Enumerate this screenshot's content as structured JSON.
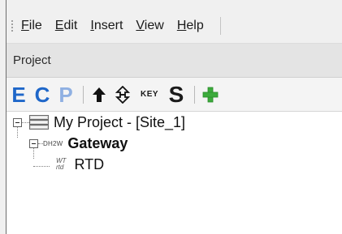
{
  "menubar": {
    "items": [
      {
        "accel": "F",
        "rest": "ile"
      },
      {
        "accel": "E",
        "rest": "dit"
      },
      {
        "accel": "I",
        "rest": "nsert"
      },
      {
        "accel": "V",
        "rest": "iew"
      },
      {
        "accel": "H",
        "rest": "elp"
      }
    ]
  },
  "panel": {
    "title": "Project"
  },
  "toolbar": {
    "e_label": "E",
    "c_label": "C",
    "p_label": "P",
    "key_label": "KEY",
    "s_label": "S",
    "icons": [
      "arrow-up-icon",
      "double-arrow-icon",
      "add-icon"
    ],
    "colors": {
      "blue": "#1f67c9",
      "disabled_blue": "#8fb0e2",
      "green": "#3cab3c"
    }
  },
  "tree": {
    "root": {
      "label": "My Project - [Site_1]",
      "icon": "server-icon"
    },
    "gateway": {
      "tag": "DH2W",
      "label": "Gateway"
    },
    "rtd": {
      "tag_top": "WT",
      "tag_bottom": "rtd",
      "label": "RTD"
    }
  }
}
